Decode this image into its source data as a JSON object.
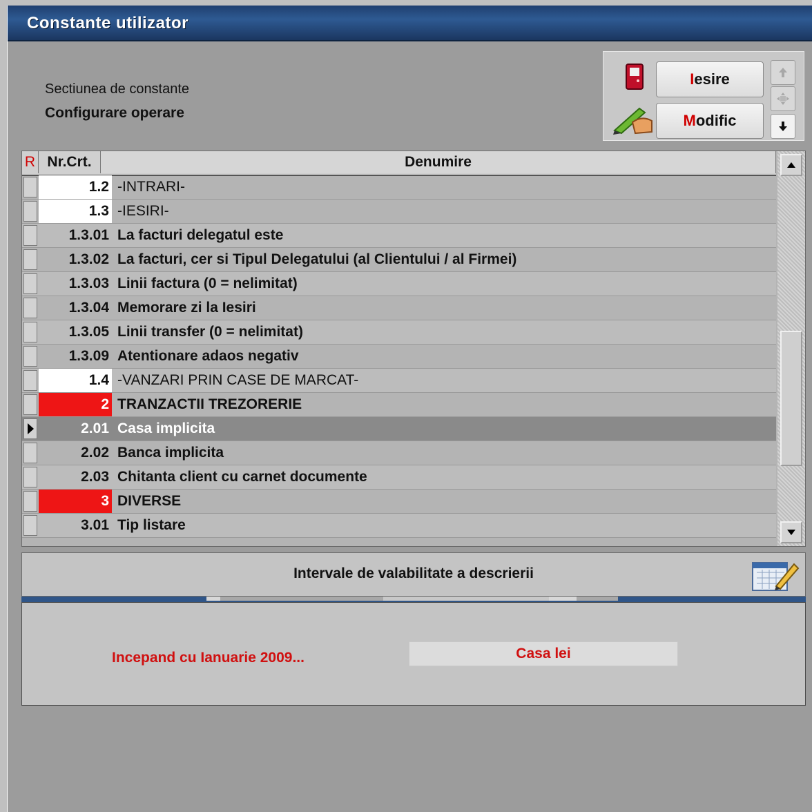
{
  "window": {
    "title": "Constante utilizator"
  },
  "section": {
    "caption": "Sectiunea de constante",
    "value": "Configurare operare"
  },
  "toolbar": {
    "exit_hot": "I",
    "exit_rest": "esire",
    "modify_hot": "M",
    "modify_rest": "odific",
    "exit_icon": "exit-door-icon",
    "modify_icon": "pencil-hand-icon",
    "up_icon": "arrow-up-icon",
    "mid_icon": "move-icon",
    "down_icon": "arrow-down-icon"
  },
  "grid": {
    "columns": {
      "r": "R",
      "nr": "Nr.Crt.",
      "denumire": "Denumire"
    },
    "rows": [
      {
        "nr": "1.2",
        "name": "-INTRARI-",
        "style": "white"
      },
      {
        "nr": "1.3",
        "name": "-IESIRI-",
        "style": "white"
      },
      {
        "nr": "1.3.01",
        "name": "La facturi delegatul este",
        "style": "bold"
      },
      {
        "nr": "1.3.02",
        "name": "La facturi, cer si Tipul Delegatului (al Clientului / al Firmei)",
        "style": "bold"
      },
      {
        "nr": "1.3.03",
        "name": "Linii factura (0 = nelimitat)",
        "style": "bold"
      },
      {
        "nr": "1.3.04",
        "name": "Memorare zi la Iesiri",
        "style": "bold"
      },
      {
        "nr": "1.3.05",
        "name": "Linii transfer (0 = nelimitat)",
        "style": "bold"
      },
      {
        "nr": "1.3.09",
        "name": "Atentionare adaos negativ",
        "style": "bold"
      },
      {
        "nr": "1.4",
        "name": "-VANZARI PRIN CASE DE MARCAT-",
        "style": "white"
      },
      {
        "nr": "2",
        "name": "TRANZACTII TREZORERIE",
        "style": "red"
      },
      {
        "nr": "2.01",
        "name": "Casa implicita",
        "style": "selected"
      },
      {
        "nr": "2.02",
        "name": "Banca implicita",
        "style": "bold"
      },
      {
        "nr": "2.03",
        "name": "Chitanta client cu carnet documente",
        "style": "bold"
      },
      {
        "nr": "3",
        "name": "DIVERSE",
        "style": "red"
      },
      {
        "nr": "3.01",
        "name": "Tip listare",
        "style": "bold"
      }
    ]
  },
  "validity": {
    "title": "Intervale de valabilitate a descrierii",
    "icon": "calendar-edit-icon",
    "interval_label": "Incepand cu Ianuarie 2009...",
    "interval_value": "Casa lei"
  },
  "colors": {
    "title_bar": "#2e5a92",
    "accent_red": "#ee1515",
    "text_red": "#d01010",
    "selected_row": "#8a8a8a"
  }
}
